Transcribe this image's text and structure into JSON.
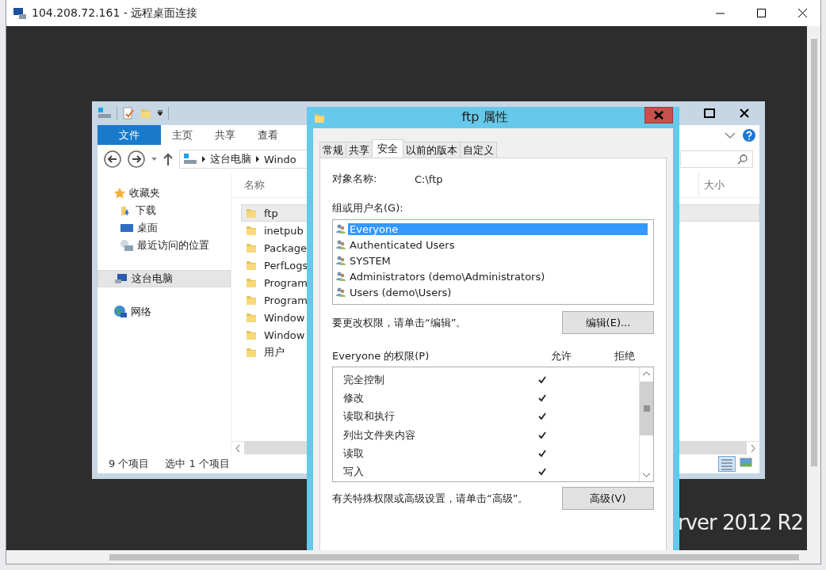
{
  "rdp_window": {
    "title": "104.208.72.161 - 远程桌面连接"
  },
  "explorer": {
    "ribbon_tabs": [
      {
        "label": "文件",
        "selected": true
      },
      {
        "label": "主页",
        "selected": false
      },
      {
        "label": "共享",
        "selected": false
      },
      {
        "label": "查看",
        "selected": false
      }
    ],
    "address": [
      "这台电脑",
      "Windo"
    ],
    "nav": [
      {
        "label": "收藏夹",
        "kind": "favorites",
        "selected": false,
        "children": [
          {
            "label": "下载",
            "kind": "downloads",
            "selected": false
          },
          {
            "label": "桌面",
            "kind": "desktop",
            "selected": false
          },
          {
            "label": "最近访问的位置",
            "kind": "recent",
            "selected": false
          }
        ]
      },
      {
        "label": "这台电脑",
        "kind": "computer",
        "selected": true
      },
      {
        "label": "网络",
        "kind": "network",
        "selected": false
      }
    ],
    "columns": [
      "名称",
      "大小"
    ],
    "files": [
      {
        "name": "ftp",
        "selected": true
      },
      {
        "name": "inetpub",
        "selected": false
      },
      {
        "name": "Package",
        "selected": false
      },
      {
        "name": "PerfLogs",
        "selected": false
      },
      {
        "name": "Program",
        "selected": false
      },
      {
        "name": "Program",
        "selected": false
      },
      {
        "name": "Window",
        "selected": false
      },
      {
        "name": "Window",
        "selected": false
      },
      {
        "name": "用户",
        "selected": false
      }
    ],
    "status": [
      "9 个项目",
      "选中 1 个项目"
    ]
  },
  "dialog": {
    "title": "ftp 属性",
    "tabs": [
      {
        "label": "常规",
        "selected": false
      },
      {
        "label": "共享",
        "selected": false
      },
      {
        "label": "安全",
        "selected": true
      },
      {
        "label": "以前的版本",
        "selected": false
      },
      {
        "label": "自定义",
        "selected": false
      }
    ],
    "object_label": "对象名称:",
    "object_value": "C:\\ftp",
    "groups_label": "组或用户名(G):",
    "groups": [
      {
        "name": "Everyone",
        "selected": true
      },
      {
        "name": "Authenticated Users",
        "selected": false
      },
      {
        "name": "SYSTEM",
        "selected": false
      },
      {
        "name": "Administrators (demo\\Administrators)",
        "selected": false
      },
      {
        "name": "Users (demo\\Users)",
        "selected": false
      }
    ],
    "edit_hint": "要更改权限，请单击“编辑”。",
    "edit_button": "编辑(E)...",
    "permissions_label": "Everyone 的权限(P)",
    "allow_heading": "允许",
    "deny_heading": "拒绝",
    "permissions": [
      {
        "name": "完全控制",
        "allow": true
      },
      {
        "name": "修改",
        "allow": true
      },
      {
        "name": "读取和执行",
        "allow": true
      },
      {
        "name": "列出文件夹内容",
        "allow": true
      },
      {
        "name": "读取",
        "allow": true
      },
      {
        "name": "写入",
        "allow": true
      }
    ],
    "advanced_hint": "有关特殊权限或高级设置，请单击“高级”。",
    "advanced_button": "高级(V)"
  },
  "desktop_text": "rver 2012 R2"
}
